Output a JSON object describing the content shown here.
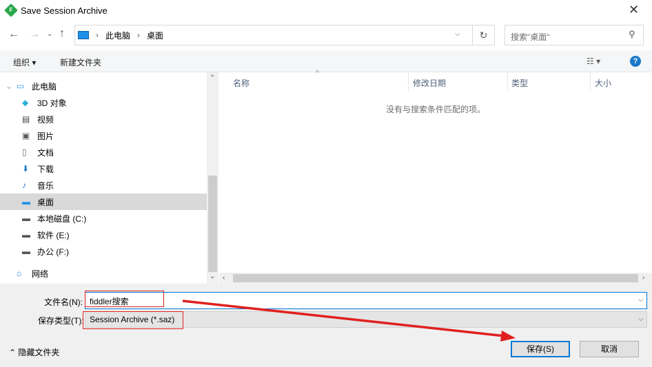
{
  "window": {
    "title": "Save Session Archive",
    "logo_letter": "F"
  },
  "nav": {
    "breadcrumb": [
      "此电脑",
      "桌面"
    ],
    "search_placeholder": "搜索\"桌面\""
  },
  "toolbar": {
    "organize": "组织 ▾",
    "new_folder": "新建文件夹"
  },
  "tree": {
    "items": [
      {
        "label": "此电脑",
        "icon": "computer-icon"
      },
      {
        "label": "3D 对象",
        "icon": "cube-icon"
      },
      {
        "label": "视频",
        "icon": "video-icon"
      },
      {
        "label": "图片",
        "icon": "picture-icon"
      },
      {
        "label": "文档",
        "icon": "document-icon"
      },
      {
        "label": "下载",
        "icon": "download-icon"
      },
      {
        "label": "音乐",
        "icon": "music-icon"
      },
      {
        "label": "桌面",
        "icon": "desktop-icon",
        "selected": true
      },
      {
        "label": "本地磁盘 (C:)",
        "icon": "drive-icon"
      },
      {
        "label": "软件 (E:)",
        "icon": "drive-icon"
      },
      {
        "label": "办公 (F:)",
        "icon": "drive-icon"
      },
      {
        "label": "网络",
        "icon": "network-icon"
      }
    ]
  },
  "columns": [
    "名称",
    "修改日期",
    "类型",
    "大小"
  ],
  "empty_message": "没有与搜索条件匹配的项。",
  "form": {
    "filename_label": "文件名(N):",
    "filename_value": "fiddler搜索",
    "filetype_label": "保存类型(T):",
    "filetype_value": "Session Archive (*.saz)"
  },
  "footer": {
    "hide_folders": "隐藏文件夹",
    "save": "保存(S)",
    "cancel": "取消"
  },
  "annotation_color": "#e02020"
}
